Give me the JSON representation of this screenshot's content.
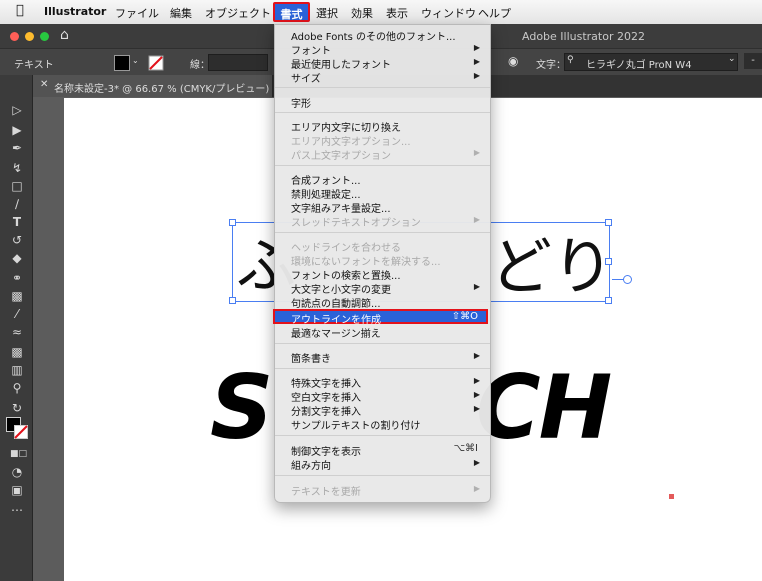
{
  "menubar": {
    "app": "Illustrator",
    "items": [
      "ファイル",
      "編集",
      "オブジェクト",
      "書式",
      "選択",
      "効果",
      "表示",
      "ウィンドウ",
      "ヘルプ"
    ]
  },
  "window": {
    "title": "Adobe Illustrator 2022"
  },
  "control": {
    "mode_label": "テキスト",
    "stroke_label": "線：",
    "char_label": "文字：",
    "font_value": "ヒラギノ丸ゴ ProN W4",
    "extra": "-"
  },
  "document": {
    "tab_title": "名称未設定-3* @ 66.67 % (CMYK/プレビュー)"
  },
  "artboard": {
    "text1": "ふわふわどり",
    "visible_left": "ふ",
    "visible_right": "どり",
    "text2_left": "S",
    "text2_right": "CH"
  },
  "menu": {
    "items": [
      {
        "label": "Adobe Fonts のその他のフォント..."
      },
      {
        "label": "フォント",
        "arrow": true
      },
      {
        "label": "最近使用したフォント",
        "arrow": true
      },
      {
        "label": "サイズ",
        "arrow": true
      },
      {
        "label": "字形"
      },
      {
        "label": "エリア内文字に切り換え"
      },
      {
        "label": "エリア内文字オプション...",
        "disabled": true
      },
      {
        "label": "パス上文字オプション",
        "disabled": true,
        "arrow": true
      },
      {
        "label": "合成フォント..."
      },
      {
        "label": "禁則処理設定..."
      },
      {
        "label": "文字組みアキ量設定..."
      },
      {
        "label": "スレッドテキストオプション",
        "disabled": true,
        "arrow": true
      },
      {
        "label": "ヘッドラインを合わせる",
        "disabled": true
      },
      {
        "label": "環境にないフォントを解決する...",
        "disabled": true
      },
      {
        "label": "フォントの検索と置換..."
      },
      {
        "label": "大文字と小文字の変更",
        "arrow": true
      },
      {
        "label": "句読点の自動調節..."
      },
      {
        "label": "アウトラインを作成",
        "shortcut": "⇧⌘O",
        "highlighted": true
      },
      {
        "label": "最適なマージン揃え"
      },
      {
        "label": "箇条書き",
        "arrow": true
      },
      {
        "label": "特殊文字を挿入",
        "arrow": true
      },
      {
        "label": "空白文字を挿入",
        "arrow": true
      },
      {
        "label": "分割文字を挿入",
        "arrow": true
      },
      {
        "label": "サンプルテキストの割り付け"
      },
      {
        "label": "制御文字を表示",
        "shortcut": "⌥⌘I"
      },
      {
        "label": "組み方向",
        "arrow": true
      },
      {
        "label": "テキストを更新",
        "disabled": true,
        "arrow": true
      }
    ]
  },
  "colors": {
    "accent": "#2a62d8",
    "highlight_border": "#e3121b"
  }
}
